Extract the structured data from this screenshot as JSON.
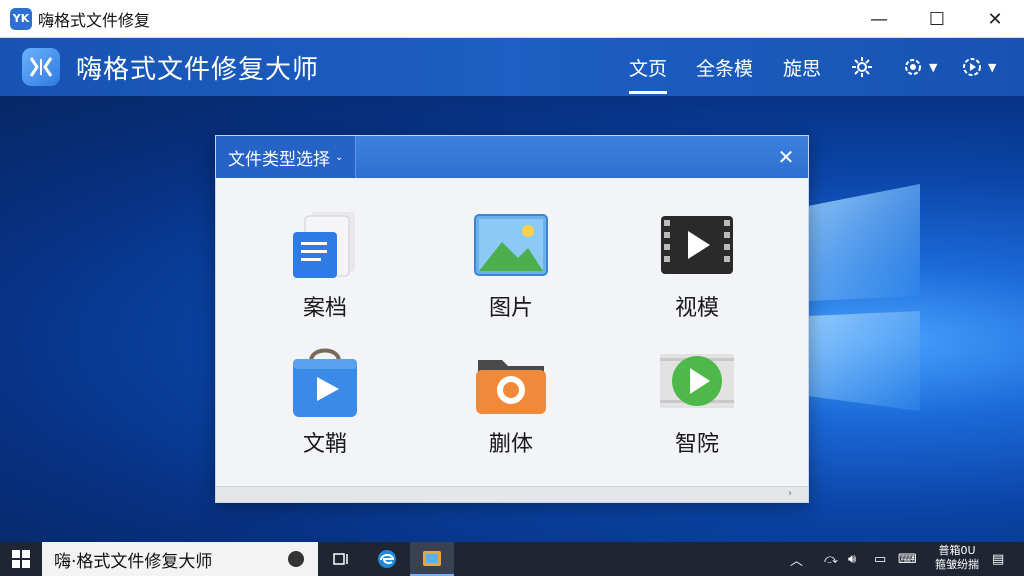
{
  "window": {
    "title": "嗨格式文件修复",
    "logo_text": "YK",
    "controls": {
      "minimize": "—",
      "maximize": "☐",
      "close": "✕"
    }
  },
  "header": {
    "app_name": "嗨格式文件修复大师",
    "nav": [
      "文页",
      "全条模",
      "旋思"
    ],
    "icons": [
      "settings-icon",
      "gear-dropdown-icon",
      "play-dropdown-icon"
    ]
  },
  "dialog": {
    "tab_label": "文件类型选择",
    "tiles": [
      {
        "label": "案档",
        "icon": "document-icon"
      },
      {
        "label": "图片",
        "icon": "image-icon"
      },
      {
        "label": "视模",
        "icon": "video-icon"
      },
      {
        "label": "文鞘",
        "icon": "bag-play-icon"
      },
      {
        "label": "蒯体",
        "icon": "folder-icon"
      },
      {
        "label": "智院",
        "icon": "green-play-icon"
      }
    ]
  },
  "taskbar": {
    "search_text": "嗨·格式文件修复大师",
    "clock_line1": "普箱0U",
    "clock_line2": "箍皱纷揣"
  },
  "colors": {
    "header_blue": "#1b5cc0",
    "dialog_head": "#2e6fd0",
    "taskbar": "#1f2532"
  }
}
